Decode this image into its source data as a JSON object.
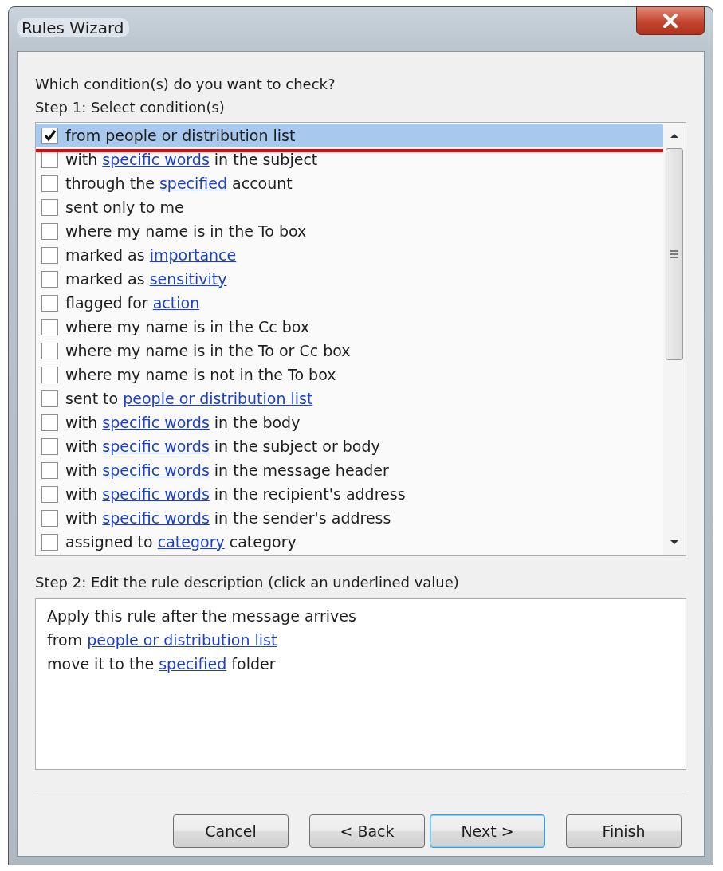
{
  "window": {
    "title": "Rules Wizard"
  },
  "question": "Which condition(s) do you want to check?",
  "step1": "Step 1: Select condition(s)",
  "conditions": [
    {
      "checked": true,
      "selected": true,
      "highlighted": true,
      "parts": [
        {
          "text": "from people or distribution list",
          "link": false
        }
      ]
    },
    {
      "checked": false,
      "selected": false,
      "highlighted": false,
      "parts": [
        {
          "text": "with ",
          "link": false
        },
        {
          "text": "specific words",
          "link": true
        },
        {
          "text": " in the subject",
          "link": false
        }
      ]
    },
    {
      "checked": false,
      "selected": false,
      "highlighted": false,
      "parts": [
        {
          "text": "through the ",
          "link": false
        },
        {
          "text": "specified",
          "link": true
        },
        {
          "text": " account",
          "link": false
        }
      ]
    },
    {
      "checked": false,
      "selected": false,
      "highlighted": false,
      "parts": [
        {
          "text": "sent only to me",
          "link": false
        }
      ]
    },
    {
      "checked": false,
      "selected": false,
      "highlighted": false,
      "parts": [
        {
          "text": "where my name is in the To box",
          "link": false
        }
      ]
    },
    {
      "checked": false,
      "selected": false,
      "highlighted": false,
      "parts": [
        {
          "text": "marked as ",
          "link": false
        },
        {
          "text": "importance",
          "link": true
        }
      ]
    },
    {
      "checked": false,
      "selected": false,
      "highlighted": false,
      "parts": [
        {
          "text": "marked as ",
          "link": false
        },
        {
          "text": "sensitivity",
          "link": true
        }
      ]
    },
    {
      "checked": false,
      "selected": false,
      "highlighted": false,
      "parts": [
        {
          "text": "flagged for ",
          "link": false
        },
        {
          "text": "action",
          "link": true
        }
      ]
    },
    {
      "checked": false,
      "selected": false,
      "highlighted": false,
      "parts": [
        {
          "text": "where my name is in the Cc box",
          "link": false
        }
      ]
    },
    {
      "checked": false,
      "selected": false,
      "highlighted": false,
      "parts": [
        {
          "text": "where my name is in the To or Cc box",
          "link": false
        }
      ]
    },
    {
      "checked": false,
      "selected": false,
      "highlighted": false,
      "parts": [
        {
          "text": "where my name is not in the To box",
          "link": false
        }
      ]
    },
    {
      "checked": false,
      "selected": false,
      "highlighted": false,
      "parts": [
        {
          "text": "sent to ",
          "link": false
        },
        {
          "text": "people or distribution list",
          "link": true
        }
      ]
    },
    {
      "checked": false,
      "selected": false,
      "highlighted": false,
      "parts": [
        {
          "text": "with ",
          "link": false
        },
        {
          "text": "specific words",
          "link": true
        },
        {
          "text": " in the body",
          "link": false
        }
      ]
    },
    {
      "checked": false,
      "selected": false,
      "highlighted": false,
      "parts": [
        {
          "text": "with ",
          "link": false
        },
        {
          "text": "specific words",
          "link": true
        },
        {
          "text": " in the subject or body",
          "link": false
        }
      ]
    },
    {
      "checked": false,
      "selected": false,
      "highlighted": false,
      "parts": [
        {
          "text": "with ",
          "link": false
        },
        {
          "text": "specific words",
          "link": true
        },
        {
          "text": " in the message header",
          "link": false
        }
      ]
    },
    {
      "checked": false,
      "selected": false,
      "highlighted": false,
      "parts": [
        {
          "text": "with ",
          "link": false
        },
        {
          "text": "specific words",
          "link": true
        },
        {
          "text": " in the recipient's address",
          "link": false
        }
      ]
    },
    {
      "checked": false,
      "selected": false,
      "highlighted": false,
      "parts": [
        {
          "text": "with ",
          "link": false
        },
        {
          "text": "specific words",
          "link": true
        },
        {
          "text": " in the sender's address",
          "link": false
        }
      ]
    },
    {
      "checked": false,
      "selected": false,
      "highlighted": false,
      "parts": [
        {
          "text": "assigned to ",
          "link": false
        },
        {
          "text": "category",
          "link": true
        },
        {
          "text": " category",
          "link": false
        }
      ]
    }
  ],
  "step2": "Step 2: Edit the rule description (click an underlined value)",
  "description": [
    [
      {
        "text": "Apply this rule after the message arrives",
        "link": false
      }
    ],
    [
      {
        "text": "from ",
        "link": false
      },
      {
        "text": "people or distribution list",
        "link": true
      }
    ],
    [
      {
        "text": "move it to the ",
        "link": false
      },
      {
        "text": "specified",
        "link": true
      },
      {
        "text": " folder",
        "link": false
      }
    ]
  ],
  "buttons": [
    {
      "label": "Cancel",
      "default": false
    },
    {
      "label": "< Back",
      "default": false
    },
    {
      "label": "Next >",
      "default": true
    },
    {
      "label": "Finish",
      "default": false
    }
  ]
}
